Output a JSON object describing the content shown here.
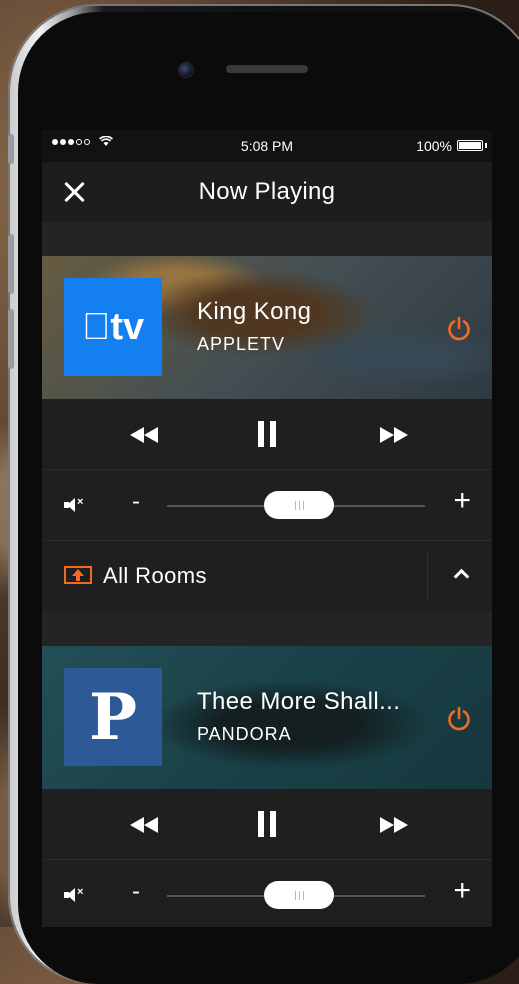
{
  "status_bar": {
    "time": "5:08 PM",
    "battery": "100%",
    "signal_bars_filled": 3,
    "signal_bars_total": 5
  },
  "header": {
    "title": "Now Playing",
    "close_icon": "close-icon"
  },
  "players": [
    {
      "tile_text": "tv",
      "tile_color": "#147ff0",
      "title": "King Kong",
      "source": "APPLETV",
      "power_color": "#f26b21",
      "volume_minus": "-",
      "volume_plus": "+",
      "rooms_label": "All Rooms"
    },
    {
      "tile_text": "P",
      "tile_color": "#2d5a96",
      "title": "Thee More Shall...",
      "source": "PANDORA",
      "power_color": "#f26b21",
      "volume_minus": "-",
      "volume_plus": "+"
    }
  ],
  "accent_color": "#f26b21"
}
